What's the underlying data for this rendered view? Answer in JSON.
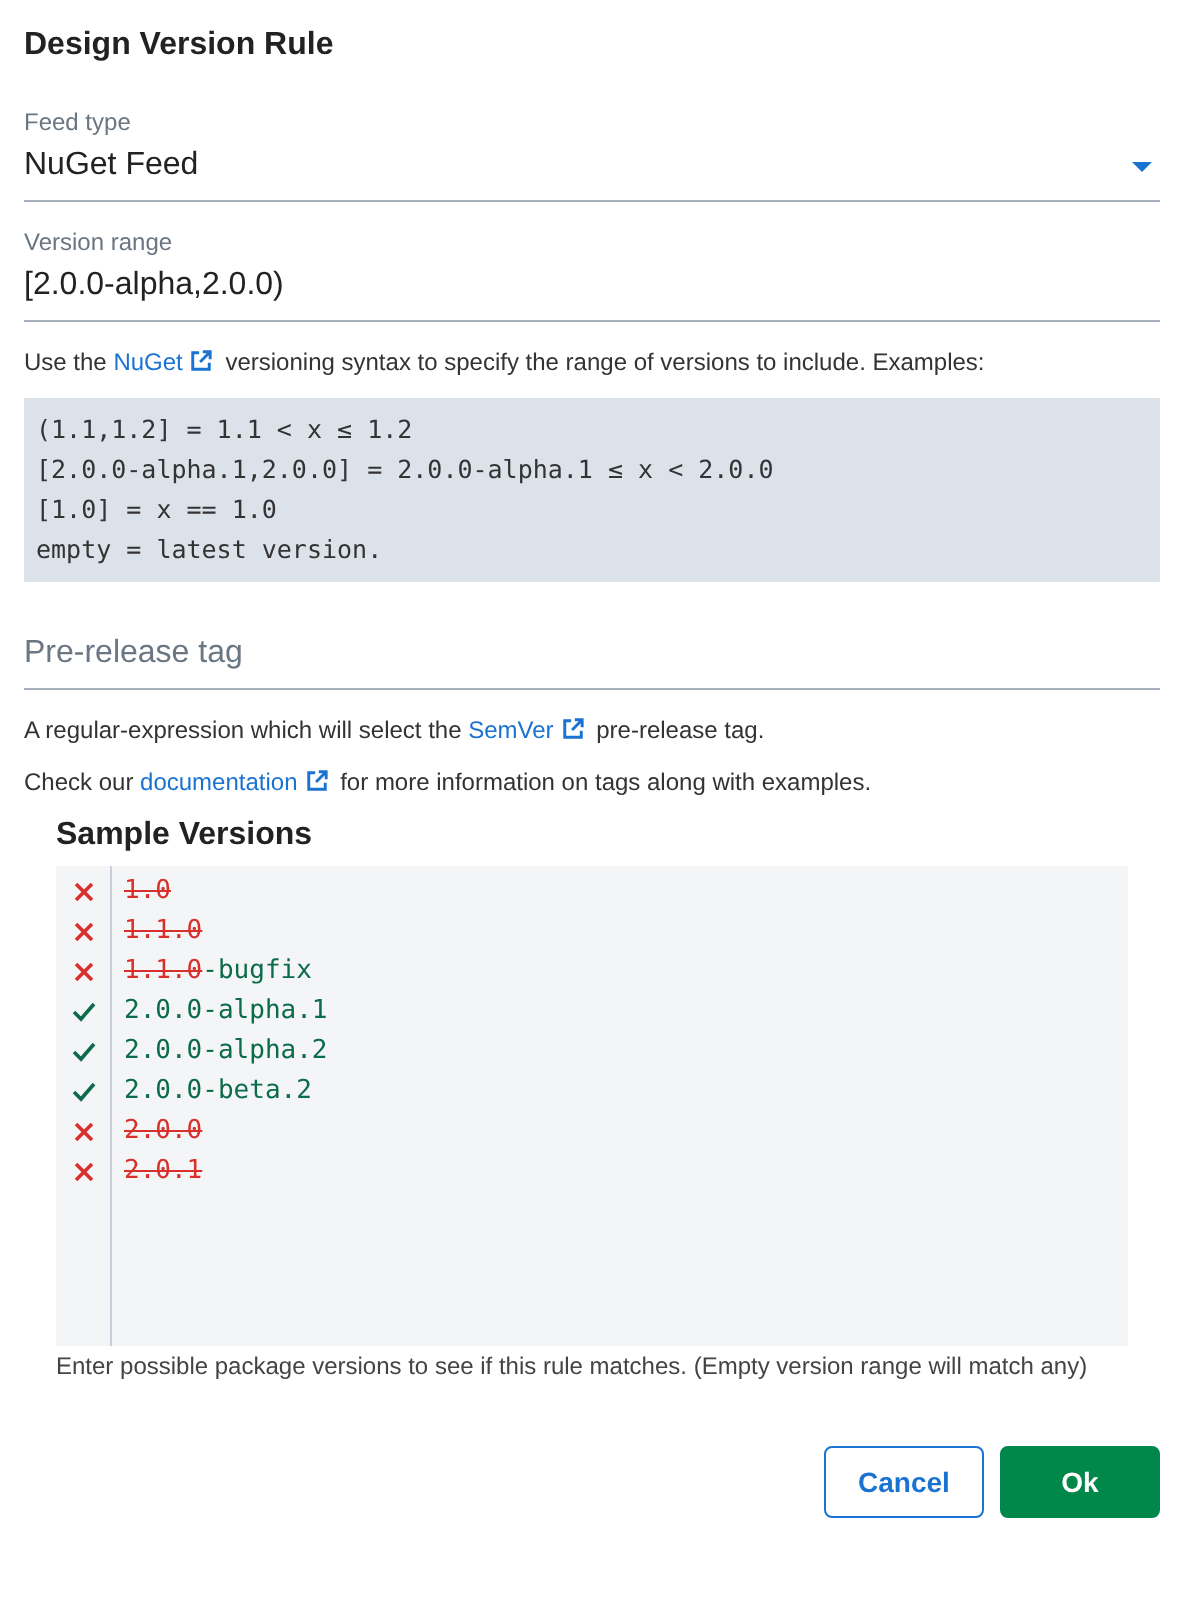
{
  "dialog": {
    "title": "Design Version Rule"
  },
  "feed_type": {
    "label": "Feed type",
    "value": "NuGet Feed"
  },
  "version_range": {
    "label": "Version range",
    "value": "[2.0.0-alpha,2.0.0)"
  },
  "range_help": {
    "before": "Use the ",
    "link": "NuGet",
    "after": " versioning syntax to specify the range of versions to include. Examples:"
  },
  "examples": [
    "(1.1,1.2] = 1.1 < x ≤ 1.2",
    "[2.0.0-alpha.1,2.0.0] = 2.0.0-alpha.1 ≤ x < 2.0.0",
    "[1.0] = x == 1.0",
    "empty = latest version."
  ],
  "prerelease_tag": {
    "placeholder": "Pre-release tag"
  },
  "tag_help": [
    {
      "before": "A regular-expression which will select the ",
      "link": "SemVer",
      "after": " pre-release tag."
    },
    {
      "before": "Check our ",
      "link": "documentation",
      "after": " for more information on tags along with examples."
    }
  ],
  "sample_versions": {
    "title": "Sample Versions",
    "lines": [
      {
        "matched": false,
        "parts": [
          {
            "text": "1.0",
            "struck": true
          }
        ]
      },
      {
        "matched": false,
        "parts": [
          {
            "text": "1.1.0",
            "struck": true
          }
        ]
      },
      {
        "matched": false,
        "parts": [
          {
            "text": "1.1.0",
            "struck": true
          },
          {
            "text": "-bugfix",
            "struck": false
          }
        ]
      },
      {
        "matched": true,
        "parts": [
          {
            "text": "2.0.0-alpha.1",
            "struck": false
          }
        ]
      },
      {
        "matched": true,
        "parts": [
          {
            "text": "2.0.0-alpha.2",
            "struck": false
          }
        ]
      },
      {
        "matched": true,
        "parts": [
          {
            "text": "2.0.0-beta.2",
            "struck": false
          }
        ]
      },
      {
        "matched": false,
        "parts": [
          {
            "text": "2.0.0",
            "struck": true
          }
        ]
      },
      {
        "matched": false,
        "parts": [
          {
            "text": "2.0.1",
            "struck": true
          }
        ]
      }
    ],
    "hint": "Enter possible package versions to see if this rule matches. (Empty version range will match any)"
  },
  "buttons": [
    {
      "label": "Cancel",
      "kind": "secondary"
    },
    {
      "label": "Ok",
      "kind": "primary"
    }
  ]
}
